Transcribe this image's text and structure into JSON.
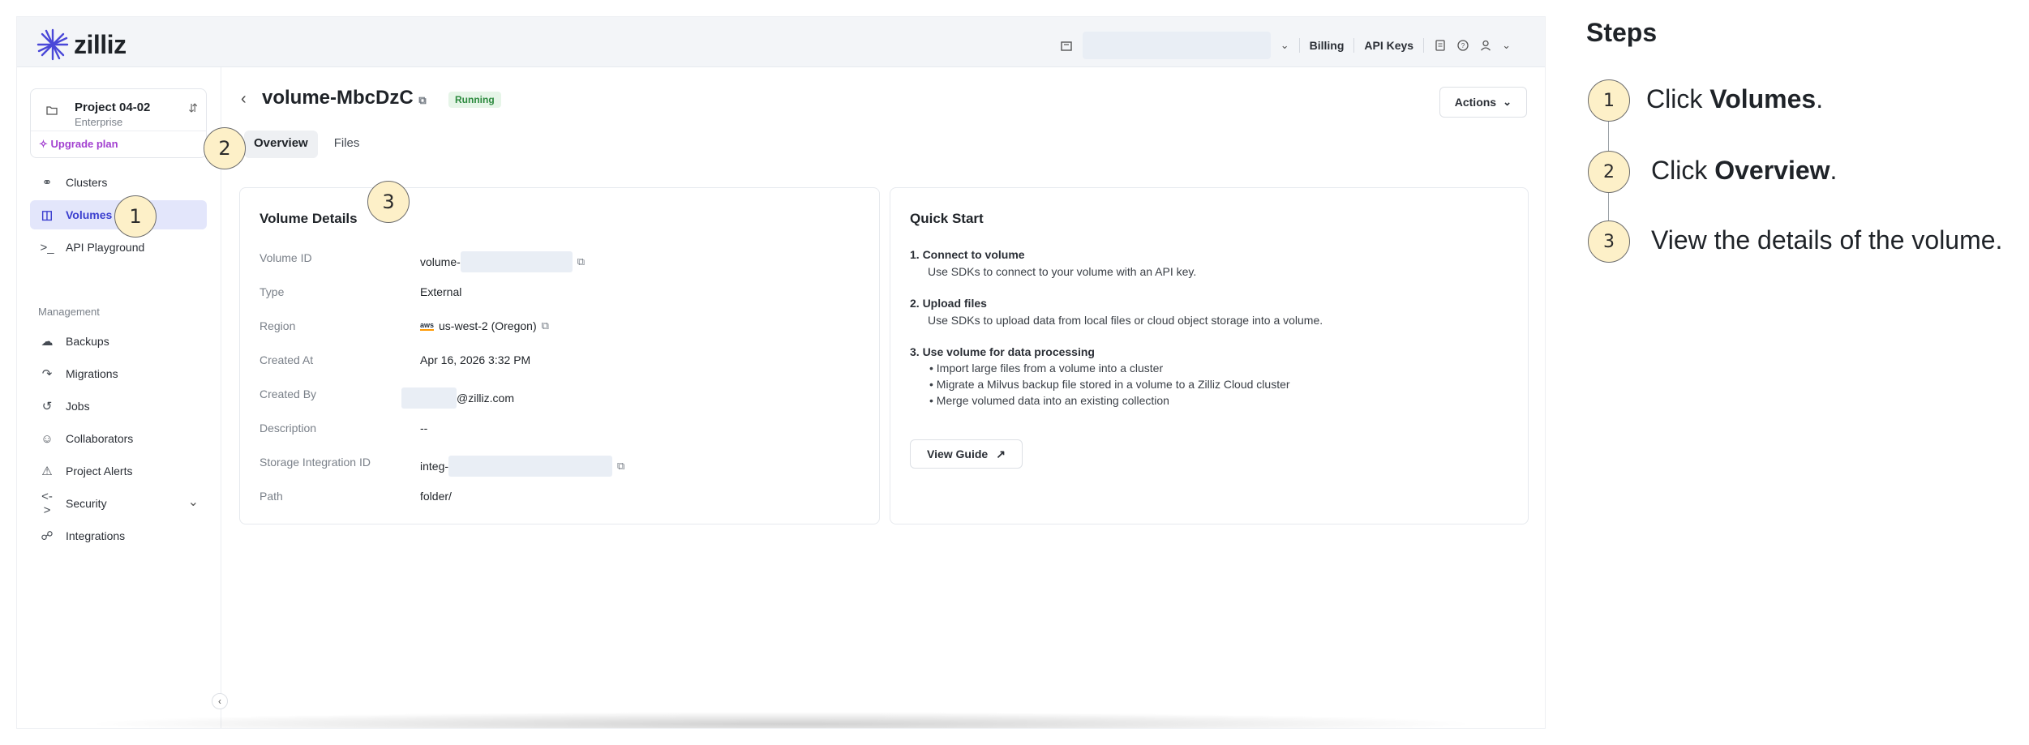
{
  "brand": {
    "logo_text": "zilliz",
    "accent": "#3b3fcf"
  },
  "topbar": {
    "billing": "Billing",
    "api_keys": "API Keys"
  },
  "sidebar": {
    "project_name": "Project 04-02",
    "project_tier": "Enterprise",
    "upgrade": "Upgrade plan",
    "items": [
      {
        "label": "Clusters",
        "icon": "clusters-icon"
      },
      {
        "label": "Volumes",
        "icon": "volume-icon"
      },
      {
        "label": "API Playground",
        "icon": "terminal-icon"
      }
    ],
    "section_management": "Management",
    "mgmt_items": [
      {
        "label": "Backups",
        "icon": "cloud-backup-icon"
      },
      {
        "label": "Migrations",
        "icon": "migration-icon"
      },
      {
        "label": "Jobs",
        "icon": "history-icon"
      },
      {
        "label": "Collaborators",
        "icon": "users-icon"
      },
      {
        "label": "Project Alerts",
        "icon": "alarm-icon"
      },
      {
        "label": "Security",
        "icon": "security-icon"
      },
      {
        "label": "Integrations",
        "icon": "integrations-icon"
      }
    ]
  },
  "main": {
    "title": "volume-MbcDzC",
    "status": "Running",
    "actions": "Actions",
    "tabs": [
      "Overview",
      "Files"
    ]
  },
  "details": {
    "title": "Volume Details",
    "rows": [
      {
        "label": "Volume ID",
        "value": "volume-"
      },
      {
        "label": "Type",
        "value": "External"
      },
      {
        "label": "Region",
        "value": "us-west-2 (Oregon)",
        "badge": "aws"
      },
      {
        "label": "Created At",
        "value": "Apr 16, 2026 3:32 PM"
      },
      {
        "label": "Created By",
        "value": "@zilliz.com"
      },
      {
        "label": "Description",
        "value": "--"
      },
      {
        "label": "Storage Integration ID",
        "value": "integ-"
      },
      {
        "label": "Path",
        "value": "folder/"
      }
    ]
  },
  "quickstart": {
    "title": "Quick Start",
    "step1_title": "1.  Connect to volume",
    "step1_desc": "Use SDKs to connect to your volume with an API key.",
    "step2_title": "2.  Upload files",
    "step2_desc": "Use SDKs to upload data from local files or cloud object storage into a volume.",
    "step3_title": "3.  Use volume for data processing",
    "step3_bullets": [
      "Import large files from a volume into a cluster",
      "Migrate a Milvus backup file stored in a volume to a Zilliz Cloud cluster",
      "Merge volumed data into an existing collection"
    ],
    "guide_button": "View Guide"
  },
  "callouts": [
    "1",
    "2",
    "3"
  ],
  "steps": {
    "title": "Steps",
    "items": [
      {
        "num": "1",
        "prefix": "Click ",
        "bold": "Volumes",
        "suffix": "."
      },
      {
        "num": "2",
        "prefix": "Click ",
        "bold": "Overview",
        "suffix": "."
      },
      {
        "num": "3",
        "prefix": "View the details of the volume.",
        "bold": "",
        "suffix": ""
      }
    ]
  }
}
